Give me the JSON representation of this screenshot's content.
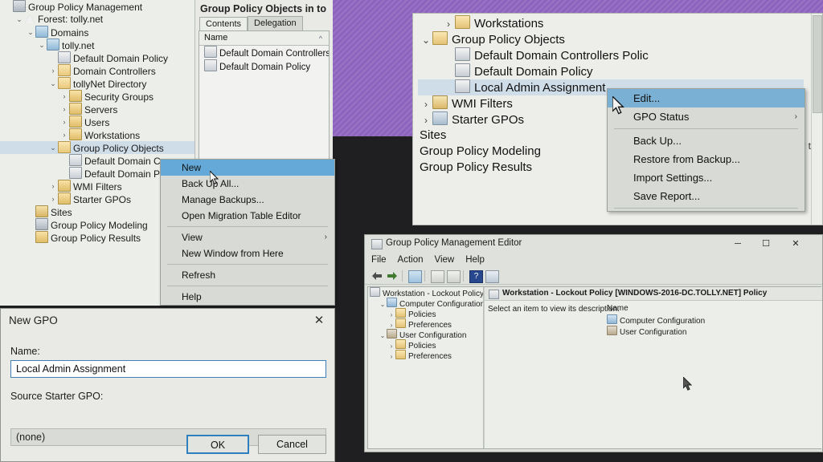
{
  "desktop": {
    "backdrop_color": "#8d63bd",
    "dark_color": "#1f1f22"
  },
  "gpmc": {
    "tree": [
      {
        "indent": 0,
        "twisty": "",
        "icon": "app",
        "label": "Group Policy Management",
        "selected": false
      },
      {
        "indent": 1,
        "twisty": "v",
        "icon": "tri",
        "label": "Forest: tolly.net",
        "selected": false
      },
      {
        "indent": 2,
        "twisty": "v",
        "icon": "domain",
        "label": "Domains",
        "selected": false
      },
      {
        "indent": 3,
        "twisty": "v",
        "icon": "domain",
        "label": "tolly.net",
        "selected": false
      },
      {
        "indent": 4,
        "twisty": "",
        "icon": "gpo",
        "label": "Default Domain Policy",
        "selected": false
      },
      {
        "indent": 4,
        "twisty": ">",
        "icon": "folder",
        "label": "Domain Controllers",
        "selected": false
      },
      {
        "indent": 4,
        "twisty": "v",
        "icon": "folder",
        "label": "tollyNet Directory",
        "selected": false
      },
      {
        "indent": 5,
        "twisty": ">",
        "icon": "folder2",
        "label": "Security Groups",
        "selected": false
      },
      {
        "indent": 5,
        "twisty": ">",
        "icon": "folder2",
        "label": "Servers",
        "selected": false
      },
      {
        "indent": 5,
        "twisty": ">",
        "icon": "folder2",
        "label": "Users",
        "selected": false
      },
      {
        "indent": 5,
        "twisty": ">",
        "icon": "folder2",
        "label": "Workstations",
        "selected": false
      },
      {
        "indent": 4,
        "twisty": "v",
        "icon": "folder",
        "label": "Group Policy Objects",
        "selected": true
      },
      {
        "indent": 5,
        "twisty": "",
        "icon": "gpo",
        "label": "Default Domain C",
        "selected": false
      },
      {
        "indent": 5,
        "twisty": "",
        "icon": "gpo",
        "label": "Default Domain P",
        "selected": false
      },
      {
        "indent": 4,
        "twisty": ">",
        "icon": "folder2",
        "label": "WMI Filters",
        "selected": false
      },
      {
        "indent": 4,
        "twisty": ">",
        "icon": "folder2",
        "label": "Starter GPOs",
        "selected": false
      },
      {
        "indent": 2,
        "twisty": "",
        "icon": "site",
        "label": "Sites",
        "selected": false
      },
      {
        "indent": 2,
        "twisty": "",
        "icon": "app",
        "label": "Group Policy Modeling",
        "selected": false
      },
      {
        "indent": 2,
        "twisty": "",
        "icon": "folder2",
        "label": "Group Policy Results",
        "selected": false
      }
    ],
    "pane_title": "Group Policy Objects in to",
    "tabs": [
      {
        "label": "Contents",
        "active": true
      },
      {
        "label": "Delegation",
        "active": false
      }
    ],
    "list_header": "Name",
    "list_items": [
      "Default Domain Controllers Polic",
      "Default Domain Policy"
    ]
  },
  "context_menu_left": {
    "items": [
      {
        "label": "New",
        "highlight": true,
        "separator_after": false,
        "submenu": false
      },
      {
        "label": "Back Up All...",
        "highlight": false,
        "separator_after": false,
        "submenu": false
      },
      {
        "label": "Manage Backups...",
        "highlight": false,
        "separator_after": false,
        "submenu": false
      },
      {
        "label": "Open Migration Table Editor",
        "highlight": false,
        "separator_after": true,
        "submenu": false
      },
      {
        "label": "View",
        "highlight": false,
        "separator_after": false,
        "submenu": true
      },
      {
        "label": "New Window from Here",
        "highlight": false,
        "separator_after": true,
        "submenu": false
      },
      {
        "label": "Refresh",
        "highlight": false,
        "separator_after": true,
        "submenu": false
      },
      {
        "label": "Help",
        "highlight": false,
        "separator_after": false,
        "submenu": false
      }
    ]
  },
  "overlay": {
    "tree": [
      {
        "indent": 1,
        "twisty": ">",
        "icon": "folder",
        "label": "Workstations",
        "selected": false
      },
      {
        "indent": 0,
        "twisty": "v",
        "icon": "folder",
        "label": "Group Policy Objects",
        "selected": false
      },
      {
        "indent": 1,
        "twisty": "",
        "icon": "gpo",
        "label": "Default Domain Controllers Polic",
        "selected": false
      },
      {
        "indent": 1,
        "twisty": "",
        "icon": "gpo",
        "label": "Default Domain Policy",
        "selected": false
      },
      {
        "indent": 1,
        "twisty": "",
        "icon": "gpo",
        "label": "Local Admin Assignment",
        "selected": true
      },
      {
        "indent": 0,
        "twisty": ">",
        "icon": "wmi",
        "label": "WMI Filters",
        "selected": false
      },
      {
        "indent": 0,
        "twisty": ">",
        "icon": "starter",
        "label": "Starter GPOs",
        "selected": false
      },
      {
        "indent": -1,
        "twisty": "",
        "icon": "none",
        "label": "Sites",
        "selected": false
      },
      {
        "indent": -1,
        "twisty": "",
        "icon": "none",
        "label": "Group Policy Modeling",
        "selected": false
      },
      {
        "indent": -1,
        "twisty": "",
        "icon": "none",
        "label": "Group Policy Results",
        "selected": false
      }
    ],
    "clipped_text": "y t"
  },
  "context_menu_middle": {
    "items": [
      {
        "label": "Edit...",
        "highlight": true,
        "separator_after": false,
        "submenu": false
      },
      {
        "label": "GPO Status",
        "highlight": false,
        "separator_after": true,
        "submenu": true
      },
      {
        "label": "Back Up...",
        "highlight": false,
        "separator_after": false,
        "submenu": false
      },
      {
        "label": "Restore from Backup...",
        "highlight": false,
        "separator_after": false,
        "submenu": false
      },
      {
        "label": "Import Settings...",
        "highlight": false,
        "separator_after": false,
        "submenu": false
      },
      {
        "label": "Save Report...",
        "highlight": false,
        "separator_after": true,
        "submenu": false
      }
    ]
  },
  "new_gpo_dialog": {
    "title": "New GPO",
    "close_glyph": "✕",
    "name_label": "Name:",
    "name_value": "Local Admin Assignment",
    "starter_label": "Source Starter GPO:",
    "starter_value": "(none)",
    "starter_caret": "⌄",
    "ok_label": "OK",
    "cancel_label": "Cancel"
  },
  "editor": {
    "title": "Group Policy Management Editor",
    "window_buttons": {
      "minimize": "─",
      "maximize": "☐",
      "close": "✕"
    },
    "menu": [
      "File",
      "Action",
      "View",
      "Help"
    ],
    "tree_root": "Workstation - Lockout Policy [V",
    "tree": [
      {
        "indent": 1,
        "twisty": "v",
        "icon": "comp",
        "label": "Computer Configuration"
      },
      {
        "indent": 2,
        "twisty": ">",
        "icon": "folder",
        "label": "Policies"
      },
      {
        "indent": 2,
        "twisty": ">",
        "icon": "folder",
        "label": "Preferences"
      },
      {
        "indent": 1,
        "twisty": "v",
        "icon": "user",
        "label": "User Configuration"
      },
      {
        "indent": 2,
        "twisty": ">",
        "icon": "folder",
        "label": "Policies"
      },
      {
        "indent": 2,
        "twisty": ">",
        "icon": "folder",
        "label": "Preferences"
      }
    ],
    "right_tab": "Workstation - Lockout Policy [WINDOWS-2016-DC.TOLLY.NET] Policy",
    "description": "Select an item to view its description.",
    "name_column_header": "Name",
    "name_column_items": [
      {
        "icon": "comp",
        "label": "Computer Configuration"
      },
      {
        "icon": "user",
        "label": "User Configuration"
      }
    ]
  }
}
